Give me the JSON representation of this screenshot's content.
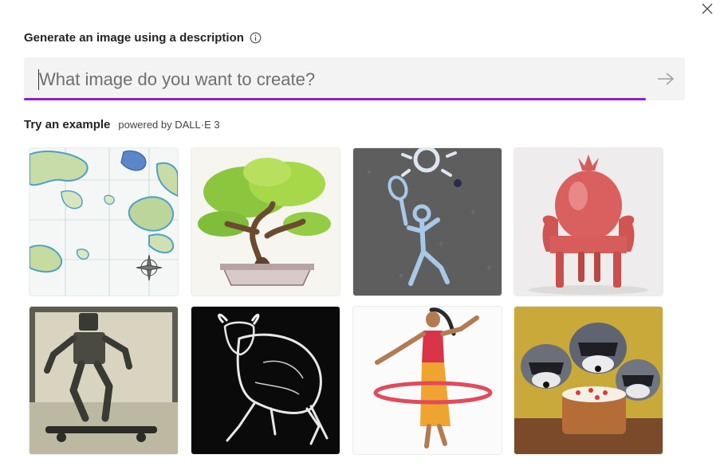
{
  "dialog": {
    "close_icon": "close-icon"
  },
  "header": {
    "title": "Generate an image using a description",
    "info_icon": "info-icon"
  },
  "prompt": {
    "placeholder": "What image do you want to create?",
    "value": "",
    "submit_icon": "arrow-right-icon",
    "accent_color": "#8a21c7"
  },
  "examples": {
    "title": "Try an example",
    "powered_by": "powered by DALL·E 3",
    "items": [
      {
        "name": "example-map",
        "subject": "watercolor map"
      },
      {
        "name": "example-bonsai",
        "subject": "bonsai tree"
      },
      {
        "name": "example-chalk-tennis",
        "subject": "chalk drawing tennis player"
      },
      {
        "name": "example-pomegranate-chair",
        "subject": "pomegranate chair"
      },
      {
        "name": "example-robot-skateboard",
        "subject": "robot on skateboard"
      },
      {
        "name": "example-bull",
        "subject": "bull sketch"
      },
      {
        "name": "example-hula-hoop",
        "subject": "woman with hula hoop"
      },
      {
        "name": "example-raccoon-cake",
        "subject": "raccoons with cake"
      }
    ]
  }
}
